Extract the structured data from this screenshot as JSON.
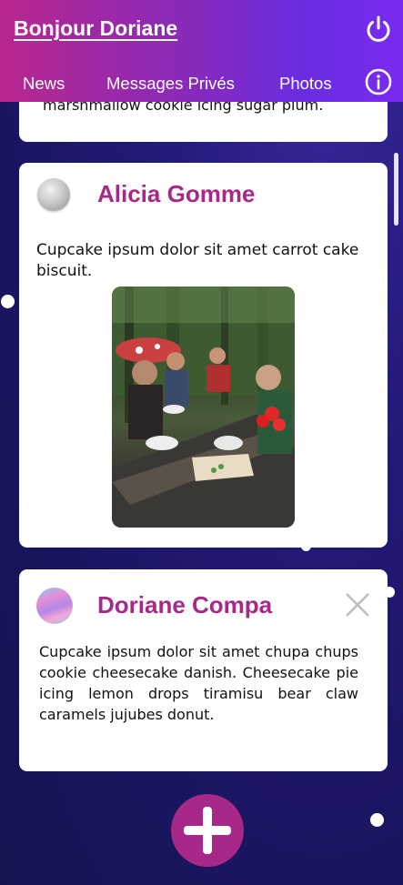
{
  "header": {
    "greeting": "Bonjour Doriane",
    "nav": [
      "News",
      "Messages Privés",
      "Photos"
    ]
  },
  "posts": [
    {
      "text_fragment": "marshmallow cookie icing sugar plum."
    },
    {
      "author": "Alicia Gomme",
      "text": "Cupcake ipsum dolor sit amet carrot cake biscuit."
    },
    {
      "author": "Doriane Compa",
      "text": "Cupcake ipsum dolor sit amet chupa chups cookie cheesecake danish. Cheesecake pie icing lemon drops tiramisu bear claw caramels jujubes donut."
    }
  ],
  "colors": {
    "accent": "#a8288a",
    "header_gradient_start": "#b8278e",
    "header_gradient_end": "#7a2bf0",
    "background": "#1a1560"
  },
  "icons": {
    "power": "power-icon",
    "info": "info-icon",
    "close": "close-icon",
    "add": "plus-icon"
  }
}
